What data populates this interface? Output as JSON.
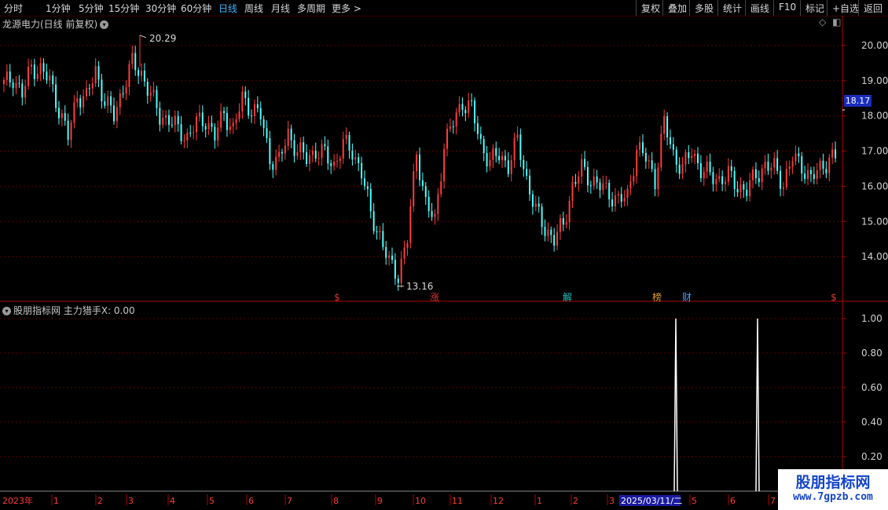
{
  "toolbar": {
    "periods": [
      "分时",
      "1分钟",
      "5分钟",
      "15分钟",
      "30分钟",
      "60分钟",
      "日线",
      "周线",
      "月线",
      "多周期",
      "更多 >"
    ],
    "active_period": "日线",
    "right_buttons": [
      "复权",
      "叠加",
      "多股",
      "统计",
      "画线",
      "F10",
      "标记",
      "+自选",
      "返回"
    ]
  },
  "main_pane": {
    "title": "龙源电力(日线 前复权)",
    "high_label": "20.29",
    "low_label": "13.16",
    "current_price": "18.17",
    "price_ticks": [
      "20.00",
      "19.00",
      "18.00",
      "17.00",
      "16.00",
      "15.00",
      "14.00"
    ],
    "markers": [
      {
        "label": "$",
        "color": "#e03030"
      },
      {
        "label": "涨",
        "color": "#e03030"
      },
      {
        "label": "解",
        "color": "#20c0c0"
      },
      {
        "label": "榜",
        "color": "#e0a020"
      },
      {
        "label": "财",
        "color": "#4aa0ff"
      },
      {
        "label": "$",
        "color": "#e03030"
      }
    ]
  },
  "indicator_pane": {
    "title": "股朋指标网  主力猎手X: 0.00",
    "ticks": [
      "1.00",
      "0.80",
      "0.60",
      "0.40",
      "0.20"
    ]
  },
  "time_axis": [
    "2023年",
    "1",
    "2",
    "3",
    "4",
    "5",
    "6",
    "7",
    "8",
    "9",
    "10",
    "11",
    "12",
    "1",
    "2",
    "3",
    "2025/03/11/二",
    "5",
    "6",
    "7"
  ],
  "watermark": {
    "title": "股朋指标网",
    "url": "www.7gpzb.com"
  },
  "colors": {
    "up": "#ff3c3c",
    "down": "#50ffff",
    "axis": "#b00000",
    "grid": "#5a0000"
  },
  "chart_data": {
    "type": "candlestick",
    "title": "龙源电力(日线 前复权)",
    "y_range": [
      13.0,
      20.4
    ],
    "highest": 20.29,
    "lowest": 13.16,
    "last": 18.17,
    "close_trend": [
      18.9,
      19.1,
      18.6,
      19.4,
      19.3,
      19.0,
      18.2,
      17.4,
      18.6,
      18.5,
      19.3,
      18.4,
      18.0,
      18.8,
      19.5,
      19.2,
      18.6,
      18.0,
      17.9,
      17.6,
      17.4,
      17.8,
      17.9,
      17.4,
      18.1,
      17.6,
      18.5,
      18.2,
      18.0,
      16.8,
      16.7,
      17.5,
      17.0,
      16.8,
      17.0,
      16.9,
      16.6,
      17.2,
      17.0,
      16.4,
      15.2,
      14.6,
      13.8,
      13.5,
      14.5,
      17.0,
      15.5,
      15.0,
      17.2,
      17.8,
      18.4,
      18.2,
      17.2,
      16.7,
      16.9,
      16.6,
      17.3,
      16.2,
      15.3,
      14.8,
      14.5,
      14.9,
      16.0,
      16.5,
      16.2,
      16.0,
      15.8,
      15.6,
      15.7,
      17.1,
      16.8,
      16.2,
      17.8,
      16.9,
      16.5,
      17.0,
      16.5,
      16.3,
      16.2,
      16.3,
      16.0,
      15.9,
      16.3,
      16.6,
      16.5,
      16.1,
      16.8,
      16.6,
      16.2,
      16.5,
      16.8
    ],
    "indicator": {
      "name": "主力猎手X",
      "value": 0.0,
      "y_ticks": [
        1.0,
        0.8,
        0.6,
        0.4,
        0.2
      ],
      "signals": [
        1.0,
        1.0
      ]
    }
  }
}
